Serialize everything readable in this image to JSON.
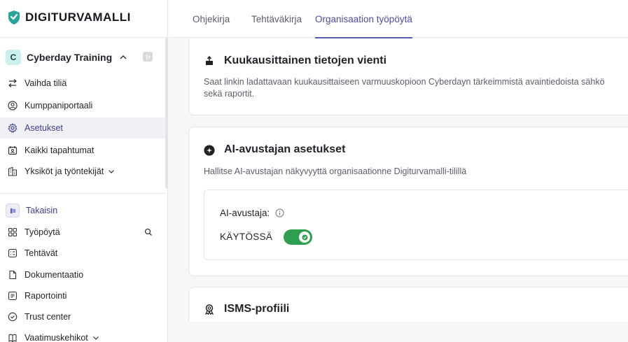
{
  "brand": {
    "name": "DIGITURVAMALLI",
    "accent": "#2aa39a"
  },
  "org": {
    "initial": "C",
    "name": "Cyberday Training"
  },
  "sidebar": {
    "top_items": [
      {
        "label": "Vaihda tiliä",
        "icon": "switch-icon"
      },
      {
        "label": "Kumppaniportaali",
        "icon": "partner-icon"
      },
      {
        "label": "Asetukset",
        "icon": "gear-icon",
        "active": true
      },
      {
        "label": "Kaikki tapahtumat",
        "icon": "events-icon"
      },
      {
        "label": "Yksiköt ja työntekijät",
        "icon": "building-icon",
        "expandable": true
      }
    ],
    "back": {
      "label": "Takaisin"
    },
    "bottom_items": [
      {
        "label": "Työpöytä",
        "icon": "dashboard-icon"
      },
      {
        "label": "Tehtävät",
        "icon": "tasks-icon"
      },
      {
        "label": "Dokumentaatio",
        "icon": "document-icon"
      },
      {
        "label": "Raportointi",
        "icon": "report-icon"
      },
      {
        "label": "Trust center",
        "icon": "shield-check-icon"
      },
      {
        "label": "Vaatimuskehikot",
        "icon": "frameworks-icon",
        "expandable": true
      }
    ]
  },
  "tabs": [
    {
      "label": "Ohjekirja"
    },
    {
      "label": "Tehtäväkirja"
    },
    {
      "label": "Organisaation työpöytä",
      "active": true
    }
  ],
  "cards": {
    "export": {
      "title": "Kuukausittainen tietojen vienti",
      "desc_line1": "Saat linkin ladattavaan kuukausittaiseen varmuuskopioon Cyberdayn tärkeimmistä avaintiedoista sähkö",
      "desc_line2": "sekä raportit."
    },
    "ai": {
      "title": "AI-avustajan asetukset",
      "desc": "Hallitse AI-avustajan näkyvyyttä organisaationne Digiturvamalli-tilillä",
      "field_label": "AI-avustaja:",
      "status": "KÄYTÖSSÄ",
      "enabled": true,
      "toggle_color": "#2f9e4f"
    },
    "isms": {
      "title": "ISMS-profiili"
    }
  }
}
